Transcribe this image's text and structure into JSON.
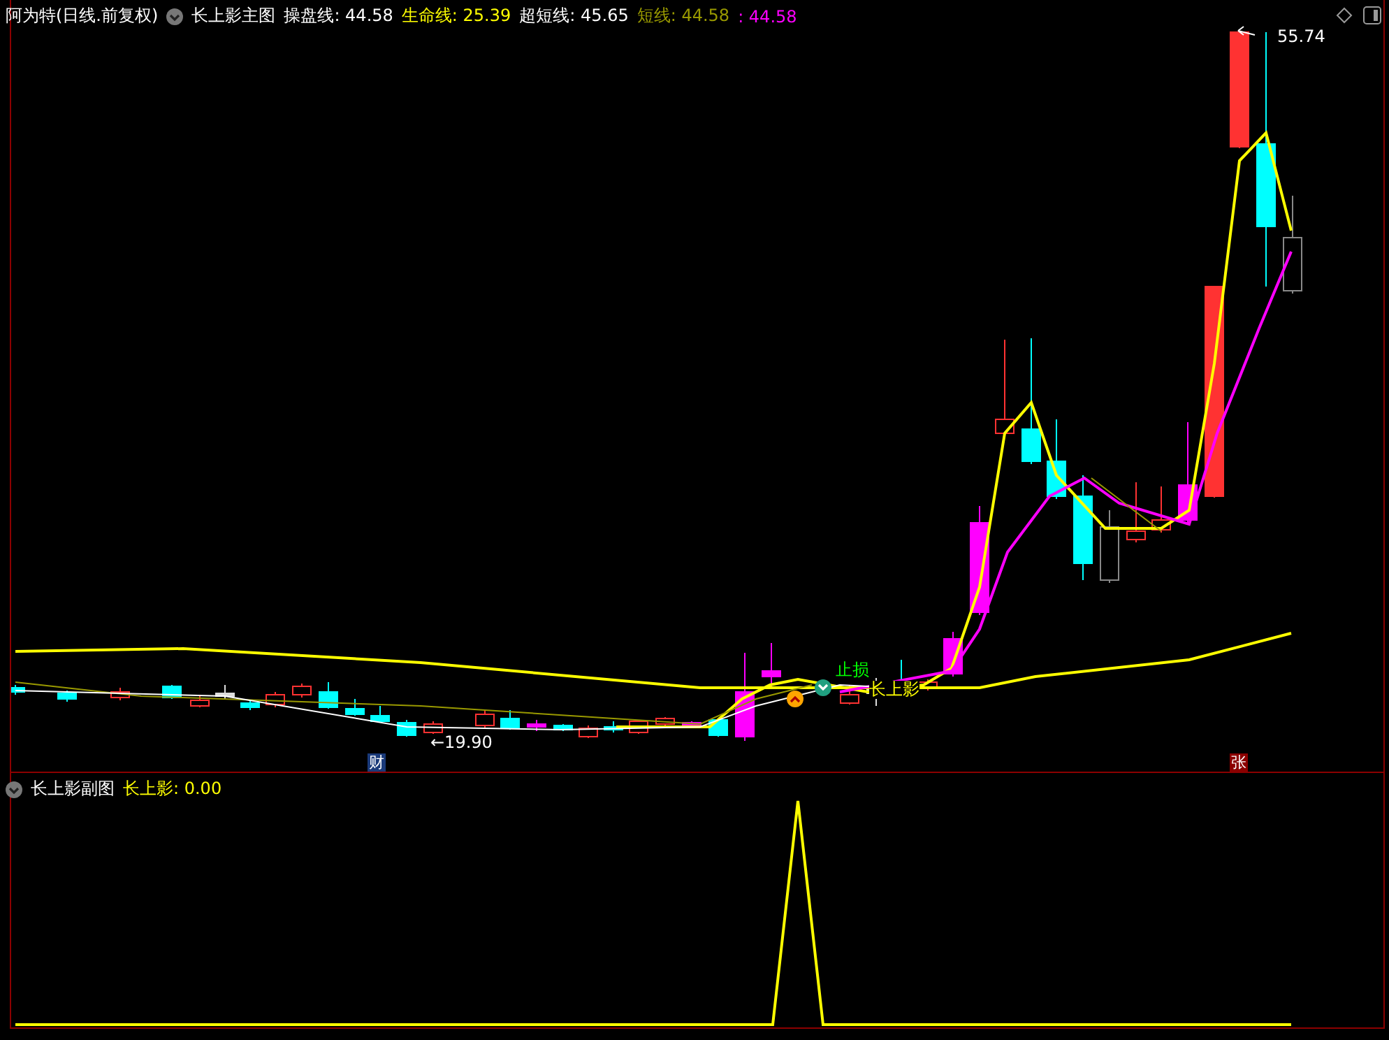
{
  "main_panel": {
    "stock": "阿为特(日线.前复权)",
    "indicator": "长上影主图",
    "readings": [
      {
        "text": "操盘线: 44.58",
        "color": "#ffffff"
      },
      {
        "text": "生命线: 25.39",
        "color": "#ffff00"
      },
      {
        "text": "超短线: 45.65",
        "color": "#ffffff"
      },
      {
        "text": "短线: 44.58",
        "color": "#999900"
      },
      {
        "text": ": 44.58",
        "color": "#ff00ff"
      }
    ],
    "price_labels": [
      {
        "text": "←19.90",
        "kind": "low"
      },
      {
        "text": "55.74",
        "kind": "high"
      }
    ],
    "badges": [
      {
        "text": "财",
        "kind": "finance"
      },
      {
        "text": "张",
        "kind": "rise"
      }
    ],
    "signals": [
      {
        "text": "止损",
        "color": "#00ff00"
      },
      {
        "text": "长上影",
        "color": "#ffff00"
      }
    ]
  },
  "sub_panel": {
    "indicator": "长上影副图",
    "readings": [
      {
        "text": "长上影: 0.00",
        "color": "#ffff00"
      }
    ]
  }
}
